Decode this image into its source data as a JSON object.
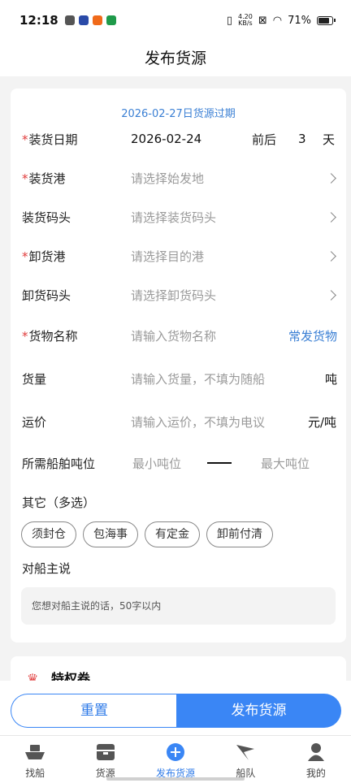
{
  "status_bar": {
    "time": "12:18",
    "net_speed_value": "4.20",
    "net_speed_unit": "KB/s",
    "battery": "71%",
    "battery_level": 0.71
  },
  "header": {
    "title": "发布货源"
  },
  "form": {
    "expire_note": "2026-02-27日货源过期",
    "load_date": {
      "label": "装货日期",
      "value": "2026-02-24",
      "range_label": "前后",
      "range_value": "3",
      "range_unit": "天"
    },
    "load_port": {
      "label": "装货港",
      "placeholder": "请选择始发地"
    },
    "load_wharf": {
      "label": "装货码头",
      "placeholder": "请选择装货码头"
    },
    "unload_port": {
      "label": "卸货港",
      "placeholder": "请选择目的港"
    },
    "unload_wharf": {
      "label": "卸货码头",
      "placeholder": "请选择卸货码头"
    },
    "goods_name": {
      "label": "货物名称",
      "placeholder": "请输入货物名称",
      "link": "常发货物"
    },
    "quantity": {
      "label": "货量",
      "placeholder": "请输入货量，不填为随船",
      "unit": "吨"
    },
    "freight": {
      "label": "运价",
      "placeholder": "请输入运价，不填为电议",
      "unit": "元/吨"
    },
    "tonnage": {
      "label": "所需船舶吨位",
      "min_placeholder": "最小吨位",
      "max_placeholder": "最大吨位"
    },
    "others": {
      "label": "其它（多选）",
      "chips": [
        "须封仓",
        "包海事",
        "有定金",
        "卸前付清"
      ]
    },
    "remark": {
      "label": "对船主说",
      "placeholder": "您想对船主说的话，50字以内"
    }
  },
  "card2": {
    "title": "特权卷"
  },
  "actions": {
    "reset": "重置",
    "publish": "发布货源"
  },
  "tabs": [
    {
      "label": "找船",
      "icon": "ship-icon"
    },
    {
      "label": "货源",
      "icon": "cargo-icon"
    },
    {
      "label": "发布货源",
      "icon": "plus-circle-icon"
    },
    {
      "label": "船队",
      "icon": "flag-icon"
    },
    {
      "label": "我的",
      "icon": "user-icon"
    }
  ],
  "colors": {
    "accent": "#3a86f5",
    "required": "#e03a3a",
    "link": "#3a7fd4"
  }
}
